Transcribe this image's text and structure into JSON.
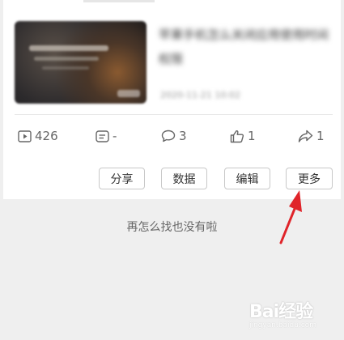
{
  "article": {
    "title": "苹果手机怎么关闭应用使用时间权限",
    "date": "2020-11-21 10:02"
  },
  "stats": {
    "plays": "426",
    "comments_doc": "-",
    "replies": "3",
    "likes": "1",
    "shares": "1"
  },
  "actions": {
    "share": "分享",
    "data": "数据",
    "edit": "编辑",
    "more": "更多"
  },
  "empty_message": "再怎么找也没有啦",
  "watermark": {
    "brand": "Bai经验",
    "url": "jingyan.baidu.com"
  },
  "colors": {
    "arrow": "#e0242a",
    "background": "#efefef"
  }
}
